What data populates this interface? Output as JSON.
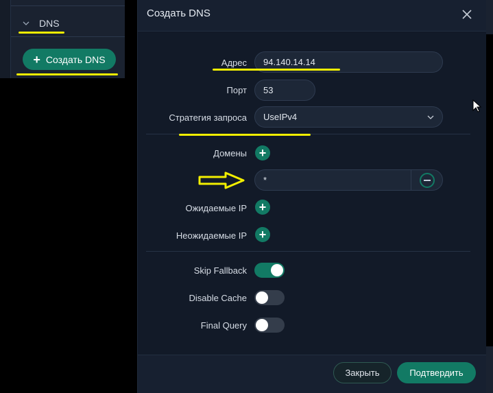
{
  "sidebar": {
    "section_label": "DNS",
    "create_button_label": "Создать DNS"
  },
  "modal": {
    "title": "Создать DNS",
    "fields": {
      "address_label": "Адрес",
      "address_value": "94.140.14.14",
      "port_label": "Порт",
      "port_value": "53",
      "strategy_label": "Стратегия запроса",
      "strategy_value": "UseIPv4",
      "domains_label": "Домены",
      "domain_value": "*",
      "expected_ip_label": "Ожидаемые IP",
      "unexpected_ip_label": "Неожидаемые IP"
    },
    "toggles": {
      "skip_fallback_label": "Skip Fallback",
      "skip_fallback": true,
      "disable_cache_label": "Disable Cache",
      "disable_cache": false,
      "final_query_label": "Final Query",
      "final_query": false
    },
    "footer": {
      "close_label": "Закрыть",
      "confirm_label": "Подтвердить"
    }
  },
  "colors": {
    "accent": "#127a64",
    "highlight": "#f2ee00",
    "background": "#121a28"
  }
}
